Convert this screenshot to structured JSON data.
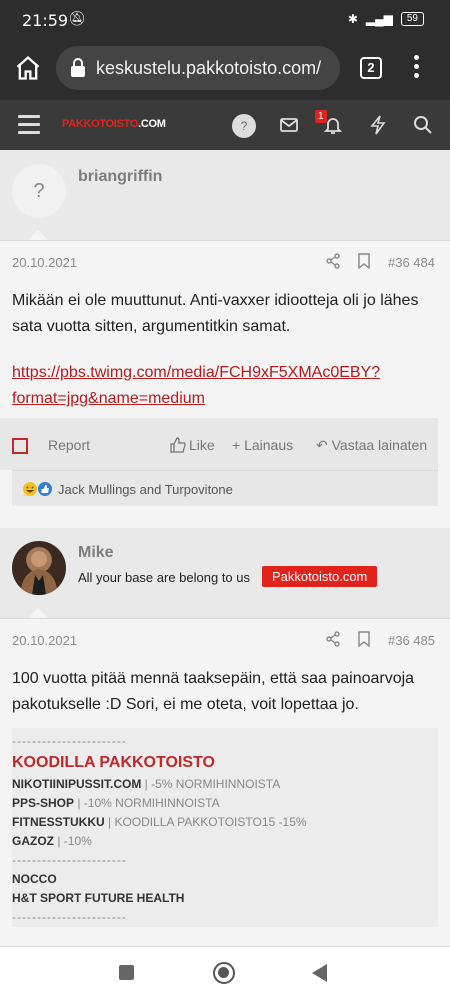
{
  "status": {
    "time": "21:59",
    "battery": "59"
  },
  "browser": {
    "url": "keskustelu.pakkotoisto.com/",
    "tab_count": "2"
  },
  "site": {
    "logo_part1": "PAKKOTOISTO",
    "logo_part2": ".COM",
    "avatar_letter": "?",
    "notif_count": "1"
  },
  "posts": [
    {
      "avatar_letter": "?",
      "username": "briangriffin",
      "date": "20.10.2021",
      "number": "#36 484",
      "body": "Mikään ei ole muuttunut. Anti-vaxxer idiootteja oli jo lähes sata vuotta sitten, argumentitkin samat.",
      "link": "https://pbs.twimg.com/media/FCH9xF5XMAc0EBY?format=jpg&name=medium",
      "actions": {
        "report": "Report",
        "like": "Like",
        "quote": "Lainaus",
        "reply": "Vastaa lainaten"
      },
      "reactions": "Jack Mullings and Turpovitone"
    },
    {
      "username": "Mike",
      "tagline": "All your base are belong to us",
      "badge": "Pakkotoisto.com",
      "date": "20.10.2021",
      "number": "#36 485",
      "body": "100 vuotta pitää mennä taaksepäin, että saa painoarvoja pakotukselle :D Sori, ei me oteta, voit lopettaa jo.",
      "signature": {
        "divider": "-----------------------",
        "title": "KOODILLA PAKKOTOISTO",
        "lines": [
          {
            "name": "NIKOTIINIPUSSIT.COM",
            "detail": " | -5% NORMIHINNOISTA"
          },
          {
            "name": "PPS-SHOP",
            "detail": " | -10% NORMIHINNOISTA"
          },
          {
            "name": "FITNESSTUKKU",
            "detail": " | KOODILLA PAKKOTOISTO15 -15%"
          },
          {
            "name": "GAZOZ",
            "detail": " | -10%"
          }
        ],
        "brands": [
          "NOCCO",
          "H&T SPORT FUTURE HEALTH"
        ]
      }
    }
  ]
}
